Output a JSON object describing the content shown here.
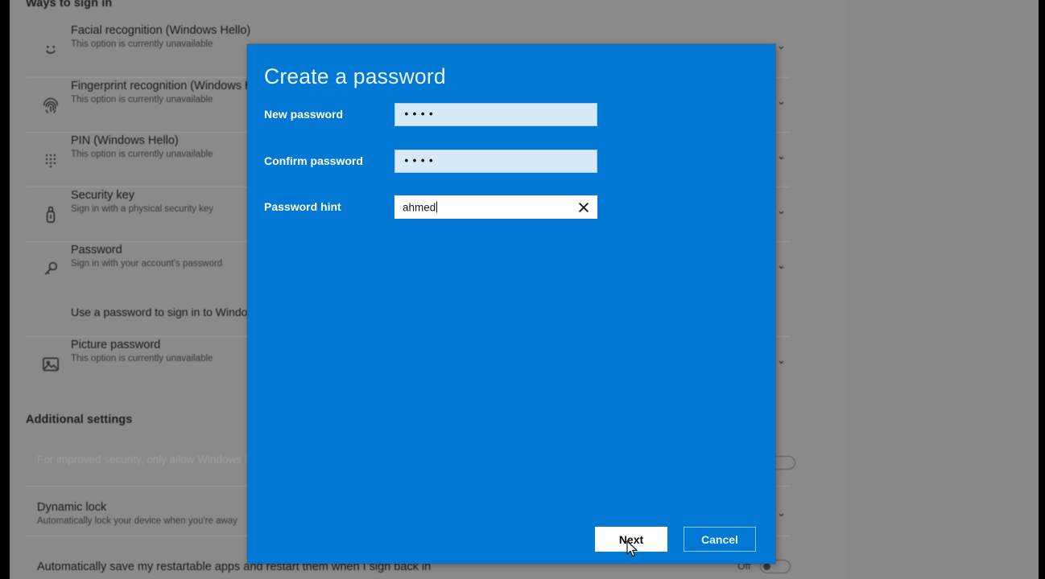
{
  "background": {
    "section_heading": "Ways to sign in",
    "additional_heading": "Additional settings",
    "signin_options": [
      {
        "icon": "face-smile-icon",
        "title": "Facial recognition (Windows Hello)",
        "subtitle": "This option is currently unavailable"
      },
      {
        "icon": "fingerprint-icon",
        "title": "Fingerprint recognition (Windows Hello)",
        "subtitle": "This option is currently unavailable"
      },
      {
        "icon": "pin-keypad-icon",
        "title": "PIN (Windows Hello)",
        "subtitle": "This option is currently unavailable"
      },
      {
        "icon": "security-key-icon",
        "title": "Security key",
        "subtitle": "Sign in with a physical security key"
      },
      {
        "icon": "key-icon",
        "title": "Password",
        "subtitle": "Sign in with your account's password"
      },
      {
        "icon": "picture-icon",
        "title": "Picture password",
        "subtitle": "This option is currently unavailable"
      }
    ],
    "password_expanded_text": "Use a password to sign in to Windows.",
    "improved_security_text": "For improved security, only allow Windows Hello sign-in for Microsoft accounts on this device (Recommended)",
    "dynamic_lock": {
      "title": "Dynamic lock",
      "subtitle": "Automatically lock your device when you're away"
    },
    "restartable_apps": {
      "title": "Automatically save my restartable apps and restart them when I sign back in",
      "toggle_state": "Off"
    }
  },
  "dialog": {
    "title": "Create a password",
    "fields": [
      {
        "label": "New password",
        "value": "••••",
        "type": "password"
      },
      {
        "label": "Confirm password",
        "value": "••••",
        "type": "password"
      },
      {
        "label": "Password hint",
        "value": "ahmed",
        "type": "text"
      }
    ],
    "buttons": {
      "next": "Next",
      "cancel": "Cancel"
    },
    "accent_color": "#0078d4",
    "field_fill_color": "#d7e9f7",
    "hint_fill_color": "#ffffff"
  }
}
